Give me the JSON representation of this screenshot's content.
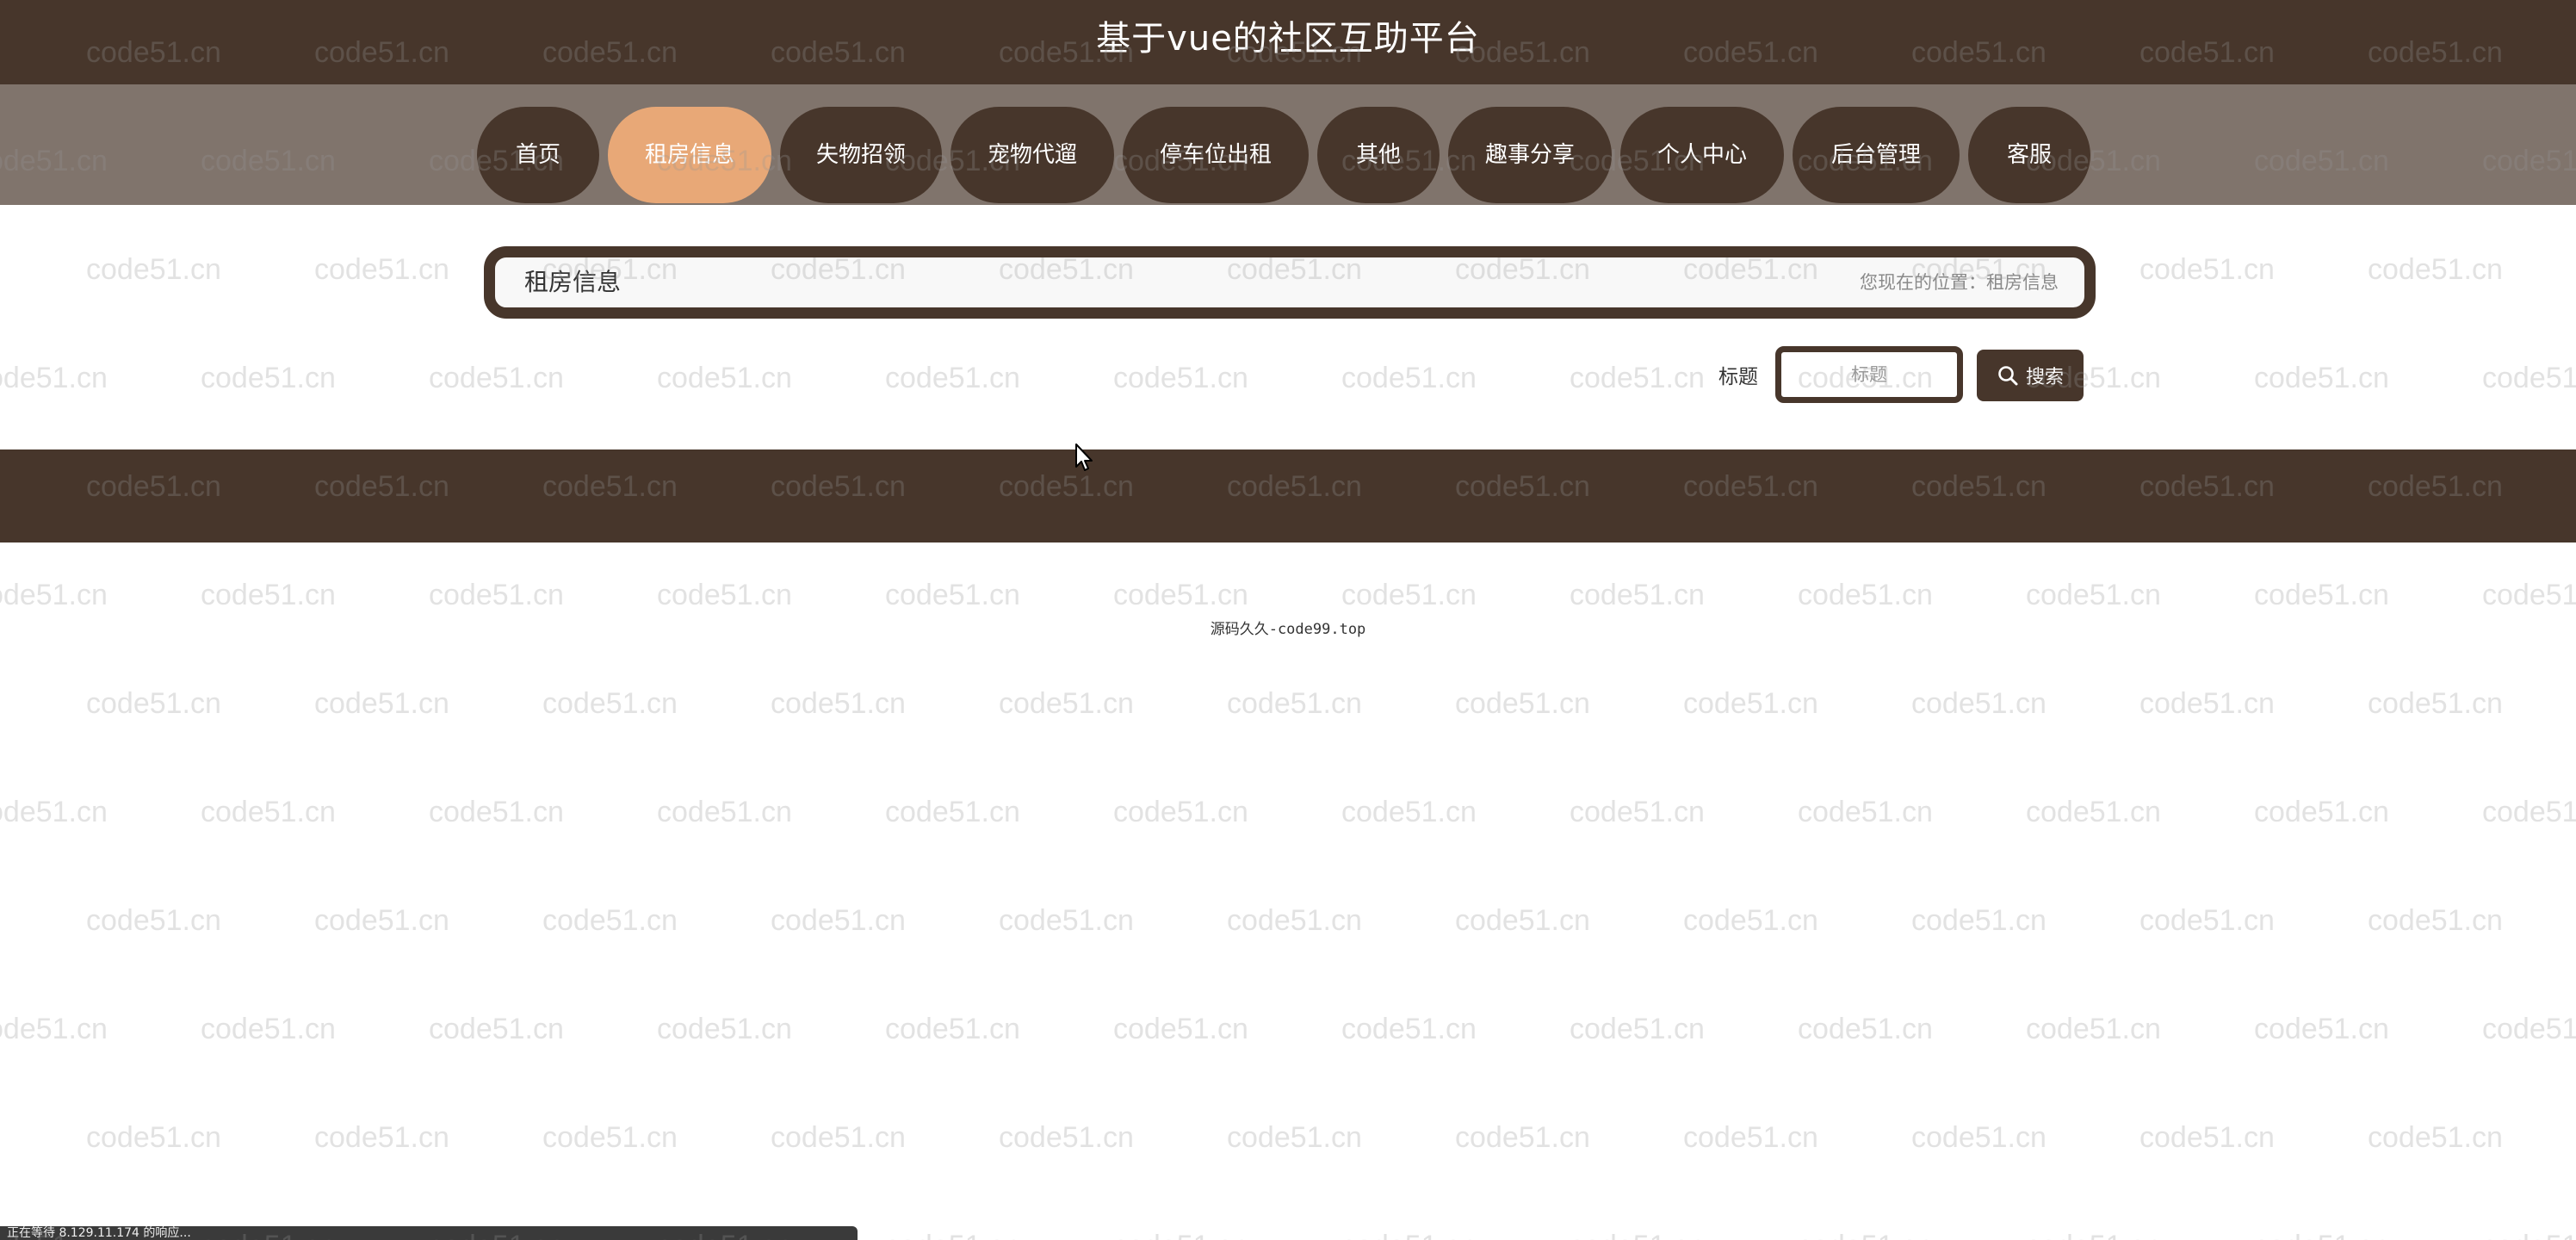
{
  "site": {
    "title": "基于vue的社区互助平台"
  },
  "nav": {
    "items": [
      {
        "label": "首页"
      },
      {
        "label": "租房信息"
      },
      {
        "label": "失物招领"
      },
      {
        "label": "宠物代遛"
      },
      {
        "label": "停车位出租"
      },
      {
        "label": "其他"
      },
      {
        "label": "趣事分享"
      },
      {
        "label": "个人中心"
      },
      {
        "label": "后台管理"
      },
      {
        "label": "客服"
      }
    ],
    "active": "租房信息"
  },
  "breadcrumb": {
    "title": "租房信息",
    "location": "您现在的位置：租房信息"
  },
  "search": {
    "label": "标题",
    "placeholder": "标题",
    "value": "",
    "button_label": "搜索"
  },
  "footer": {
    "credit": "源码久久-code99.top"
  },
  "watermark": {
    "text": "code51.cn"
  },
  "status_bar": {
    "text": "正在等待 8.129.11.174 的响应..."
  },
  "colors": {
    "primary": "#47362b",
    "accent": "#e8a877",
    "nav_band": "#80746c"
  },
  "icons": {
    "search_button": "search-icon",
    "cursor": "arrow-cursor-icon"
  }
}
